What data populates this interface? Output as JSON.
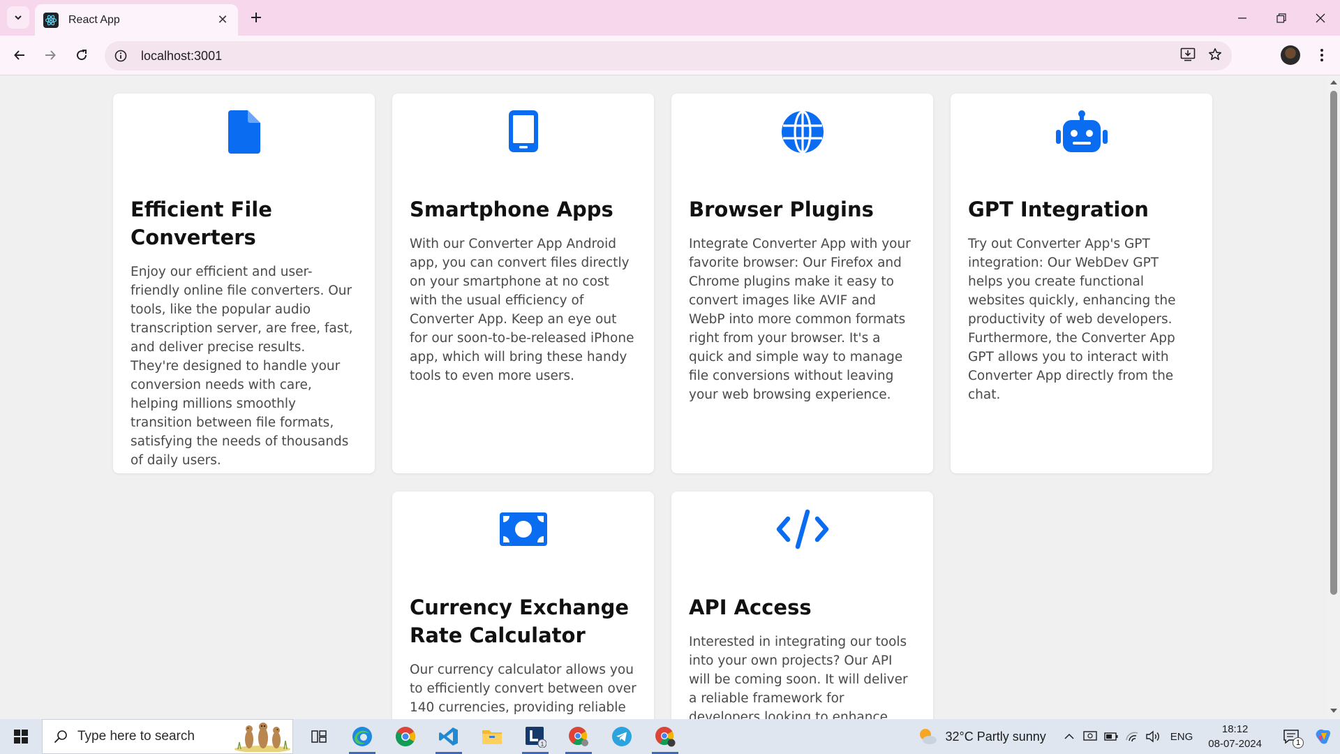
{
  "browser": {
    "tab_title": "React App",
    "url": "localhost:3001"
  },
  "colors": {
    "accent_icon": "#0a6cf0",
    "tabbar_bg": "#f6d7ec",
    "page_bg": "#f0f0f0"
  },
  "features": [
    {
      "icon": "file-icon",
      "title": "Efficient File Converters",
      "text": "Enjoy our efficient and user-friendly online file converters. Our tools, like the popular audio transcription server, are free, fast, and deliver precise results. They're designed to handle your conversion needs with care, helping millions smoothly transition between file formats, satisfying the needs of thousands of daily users."
    },
    {
      "icon": "smartphone-icon",
      "title": "Smartphone Apps",
      "text": "With our Converter App Android app, you can convert files directly on your smartphone at no cost with the usual efficiency of Converter App. Keep an eye out for our soon-to-be-released iPhone app, which will bring these handy tools to even more users."
    },
    {
      "icon": "globe-icon",
      "title": "Browser Plugins",
      "text": "Integrate Converter App with your favorite browser: Our Firefox and Chrome plugins make it easy to convert images like AVIF and WebP into more common formats right from your browser. It's a quick and simple way to manage file conversions without leaving your web browsing experience."
    },
    {
      "icon": "robot-icon",
      "title": "GPT Integration",
      "text": "Try out Converter App's GPT integration: Our WebDev GPT helps you create functional websites quickly, enhancing the productivity of web developers. Furthermore, the Converter App GPT allows you to interact with Converter App directly from the chat."
    },
    {
      "icon": "money-bill-icon",
      "title": "Currency Exchange Rate Calculator",
      "text": "Our currency calculator allows you to efficiently convert between over 140 currencies, providing reliable and up-to-date exchange rates for"
    },
    {
      "icon": "code-icon",
      "title": "API Access",
      "text": "Interested in integrating our tools into your own projects? Our API will be coming soon. It will deliver a reliable framework for developers looking to enhance their software"
    }
  ],
  "taskbar": {
    "search_placeholder": "Type here to search",
    "weather": "32°C  Partly sunny",
    "language": "ENG",
    "time": "18:12",
    "date": "08-07-2024",
    "apps": [
      "task-view-icon",
      "edge-icon",
      "chrome-icon",
      "vscode-icon",
      "file-explorer-icon",
      "app-l-icon",
      "chrome-profile-icon",
      "telegram-icon",
      "chrome-active-icon"
    ],
    "notification_count": "1"
  }
}
